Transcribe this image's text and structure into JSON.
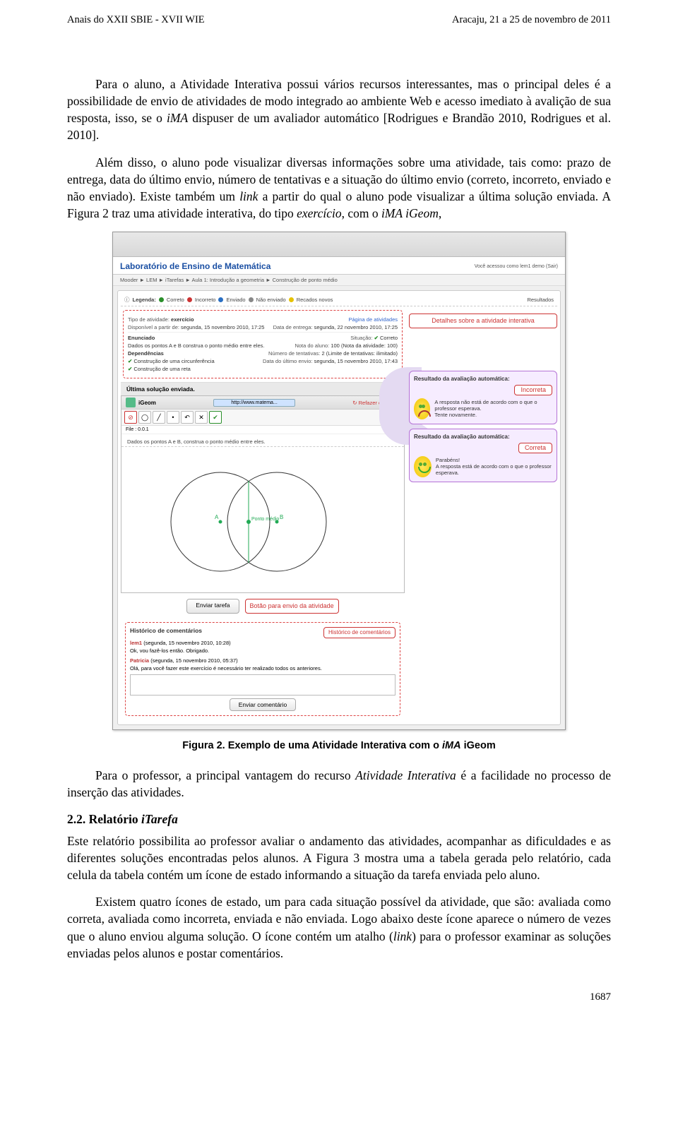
{
  "header": {
    "left": "Anais do XXII SBIE - XVII WIE",
    "right": "Aracaju, 21 a 25 de novembro de 2011"
  },
  "paragraphs": {
    "p1_a": "Para o aluno, a Atividade Interativa possui vários recursos interessantes, mas o principal deles é a possibilidade de envio de atividades de modo integrado ao ambiente Web e acesso imediato à avalição de sua resposta, isso, se o ",
    "p1_b": "iMA",
    "p1_c": " dispuser de um avaliador automático [Rodrigues e Brandão 2010, Rodrigues et al. 2010].",
    "p2_a": "Além disso, o aluno pode visualizar diversas informações sobre uma atividade, tais como: prazo de entrega, data do último envio, número de tentativas e a situação do último envio (correto, incorreto, enviado e não enviado). Existe também um ",
    "p2_b": "link",
    "p2_c": " a partir do qual o aluno pode visualizar a última solução enviada. A Figura 2 traz uma atividade interativa, do tipo ",
    "p2_d": "exercício",
    "p2_e": ", com o ",
    "p2_f": "iMA iGeom",
    "p2_g": ",",
    "p3_a": "Para o professor, a principal vantagem do recurso ",
    "p3_b": "Atividade Interativa",
    "p3_c": " é a facilidade no processo de inserção das atividades.",
    "p4": "Este relatório possibilita ao professor avaliar o andamento das atividades, acompanhar as dificuldades e as diferentes soluções encontradas pelos alunos. A Figura 3 mostra uma a tabela gerada pelo relatório, cada celula da tabela contém um ícone de estado informando a situação da tarefa enviada pelo aluno.",
    "p5_a": "Existem quatro ícones de estado, um para cada situação possível da atividade, que são: avaliada como correta, avaliada como incorreta, enviada e não enviada. Logo abaixo deste ícone aparece o número de vezes que o aluno enviou alguma solução. O ícone contém um atalho (",
    "p5_b": "link",
    "p5_c": ") para o professor examinar as soluções enviadas pelos alunos e postar comentários."
  },
  "section": {
    "num": "2.2.",
    "title": "Relatório",
    "title_it": "iTarefa"
  },
  "figure2": {
    "caption_b": "Figura 2. Exemplo de uma Atividade Interativa com o ",
    "caption_it": "iMA",
    "caption_tail": " iGeom",
    "labTitle": "Laboratório de Ensino de Matemática",
    "userText": "Você acessou como lem1 demo (Sair)",
    "breadcrumb": "Mooder ► LEM ► iTarefas ► Aula 1: Introdução a geometria ► Construção de ponto médio",
    "legend": {
      "prefix": "Legenda:",
      "l1": "Correto",
      "l2": "Incorreto",
      "l3": "Enviado",
      "l4": "Não enviado",
      "l5": "Recados novos",
      "right": "Resultados"
    },
    "details": {
      "tipoL": "Tipo de atividade:",
      "tipoV": "exercício",
      "pagR": "Página de atividades",
      "dispL": "Disponível a partir de:",
      "dispV": "segunda, 15 novembro 2010, 17:25",
      "entL": "Data de entrega:",
      "entV": "segunda, 22 novembro 2010, 17:25",
      "enunT": "Enunciado",
      "sitL": "Situação:",
      "sitV": "Correto",
      "enunV": "Dados os pontos A e B construa o ponto médio entre eles.",
      "notaL": "Nota do aluno:",
      "notaV": "100 (Nota da atividade: 100)",
      "depT": "Dependências",
      "ntL": "Número de tentativas:",
      "ntV": "2 (Limite de tentativas: ilimitado)",
      "dep1": "Construção de uma circunferência",
      "dueL": "Data do último envio:",
      "dueV": "segunda, 15 novembro 2010, 17:43",
      "dep2": "Construção de uma reta"
    },
    "lastSolTitle": "Última solução enviada.",
    "igeom": {
      "title": "iGeom",
      "url": "http://www.matema...",
      "redo": "Refazer exercício",
      "fileLabel": "File : 0.0.1",
      "prompt": "Dados os pontos A e B, construa o ponto médio entre eles."
    },
    "send": {
      "btn": "Enviar tarefa",
      "callout": "Botão para envio da atividade"
    },
    "rside": {
      "callDetails": "Detalhes sobre a atividade interativa",
      "boxTitle": "Resultado da avaliação automática:",
      "incorrect": "Incorreta",
      "incMsg1": "A resposta não está de acordo com o que o professor esperava.",
      "incMsg2": "Tente novamente.",
      "correct": "Correta",
      "corMsg1": "Parabéns!",
      "corMsg2": "A resposta está de acordo com o que o professor esperava."
    },
    "comments": {
      "title": "Histórico de comentários",
      "callout": "Histórico de comentários",
      "u1": "lem1",
      "t1": "(segunda, 15 novembro 2010, 10:28)",
      "m1": "Ok, vou fazê-los então. Obrigado.",
      "u2": "Patricia",
      "t2": "(segunda, 15 novembro 2010, 05:37)",
      "m2": "Olá, para você fazer este exercício é necessário ter realizado todos os anteriores.",
      "sendBtn": "Enviar comentário"
    }
  },
  "pageNumber": "1687"
}
